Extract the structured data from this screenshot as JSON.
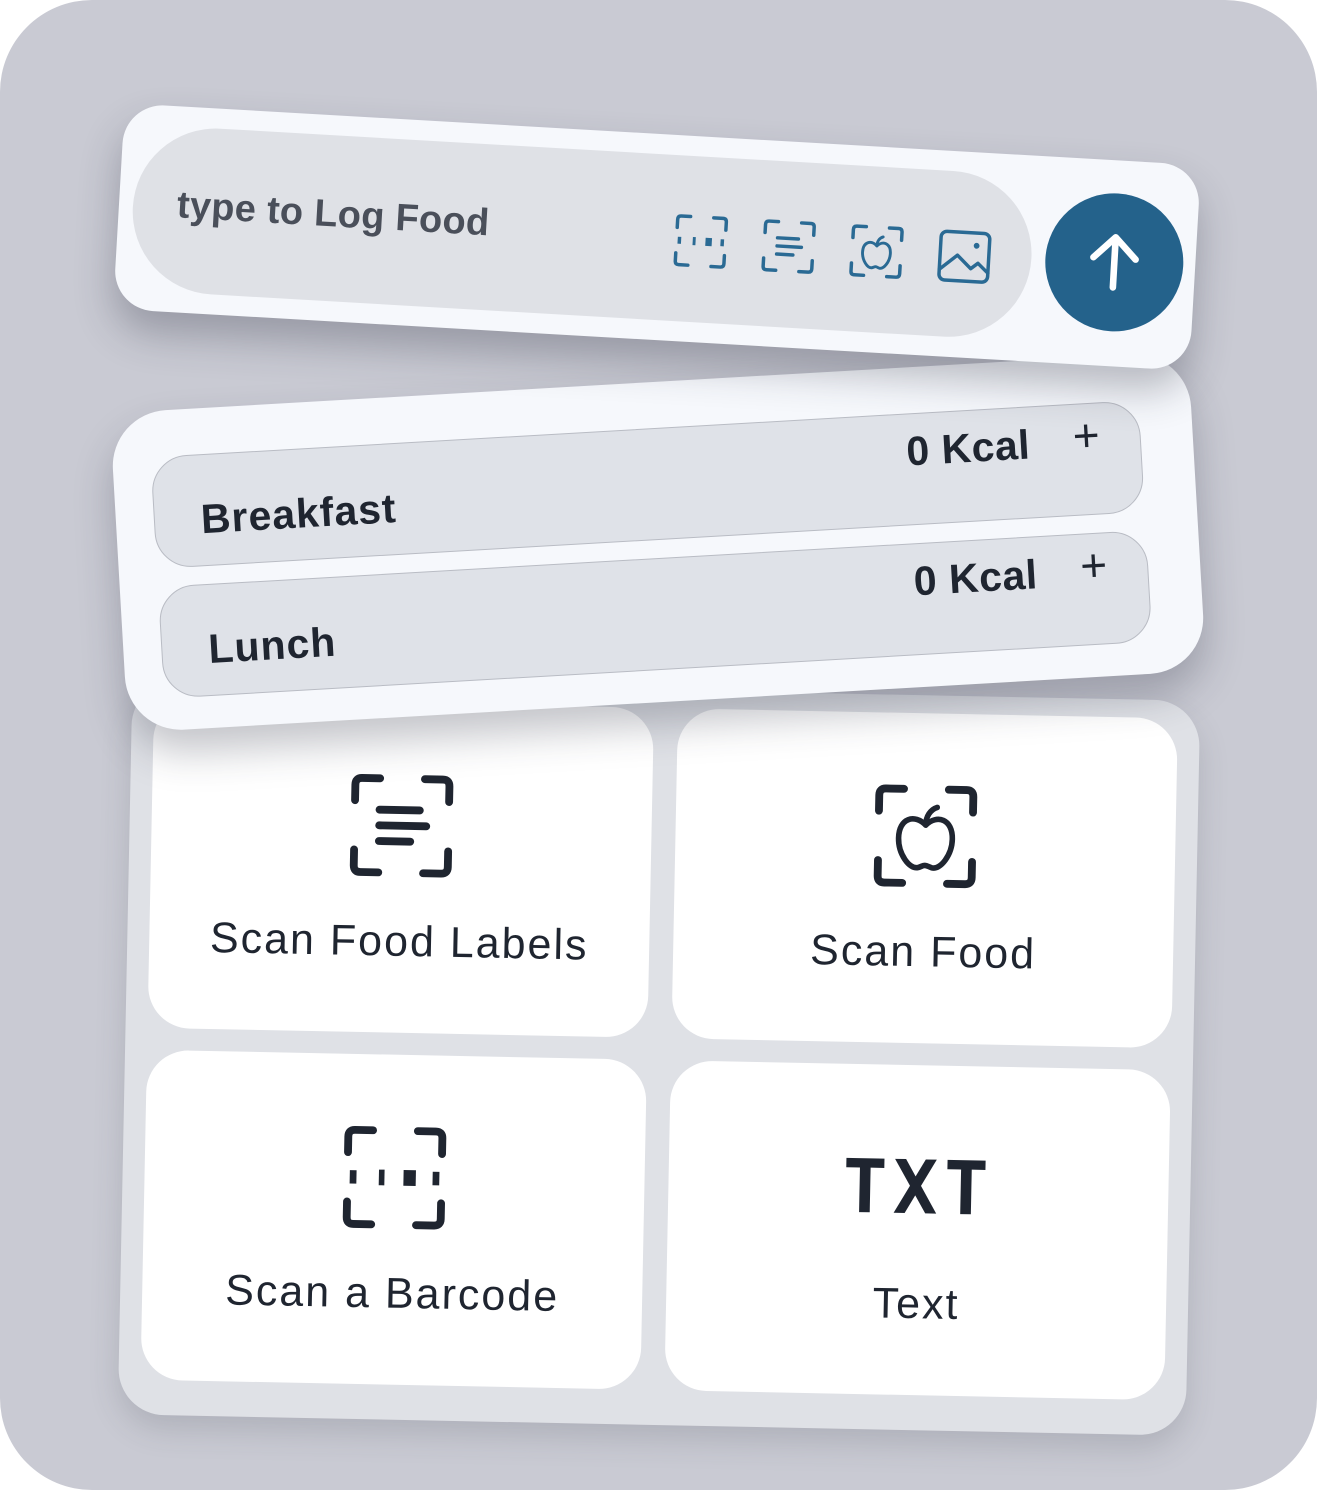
{
  "log_bar": {
    "placeholder": "type to Log Food",
    "icons": [
      "barcode-scan-icon",
      "label-scan-icon",
      "food-scan-icon",
      "image-icon"
    ],
    "send_icon": "arrow-up-icon",
    "accent_color": "#24628b"
  },
  "meals": [
    {
      "name": "Breakfast",
      "kcal": "0 Kcal",
      "add": "+"
    },
    {
      "name": "Lunch",
      "kcal": "0 Kcal",
      "add": "+"
    }
  ],
  "tiles": [
    {
      "label": "Scan Food Labels",
      "icon": "label-scan-icon"
    },
    {
      "label": "Scan Food",
      "icon": "food-scan-icon"
    },
    {
      "label": "Scan a Barcode",
      "icon": "barcode-scan-icon"
    },
    {
      "label": "Text",
      "icon_text": "TXT"
    }
  ]
}
